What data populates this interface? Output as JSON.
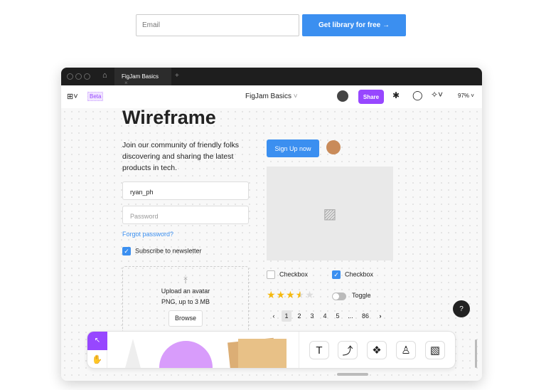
{
  "signup": {
    "email_placeholder": "Email",
    "cta": "Get library for free →"
  },
  "window": {
    "tab": "FigJam Basics",
    "tab_close": "×",
    "new_tab": "+"
  },
  "toolbar": {
    "beta": "Beta",
    "file_name": "FigJam Basics",
    "share": "Share",
    "zoom": "97%"
  },
  "wireframe": {
    "title": "Wireframe",
    "intro": "Join our community of friendly folks discovering and sharing the latest products in tech.",
    "username": "ryan_ph",
    "password_placeholder": "Password",
    "forgot": "Forgot password?",
    "subscribe": "Subscribe to newsletter",
    "upload_title": "Upload an avatar",
    "upload_hint": "PNG, up to 3 MB",
    "browse": "Browse",
    "signup": "Sign Up now",
    "checkbox1": "Checkbox",
    "checkbox2": "Checkbox",
    "toggle": "Toggle",
    "rating": 3.5,
    "rating_max": 5,
    "pages": [
      "1",
      "2",
      "3",
      "4",
      "5",
      "...",
      "86"
    ],
    "current_page": "1"
  },
  "help": "?",
  "colors": {
    "accent": "#3b8ff0",
    "share": "#9747ff",
    "select_tool": "#9747ff",
    "shape": "#d89cfb",
    "sticky": "#e8c187"
  }
}
